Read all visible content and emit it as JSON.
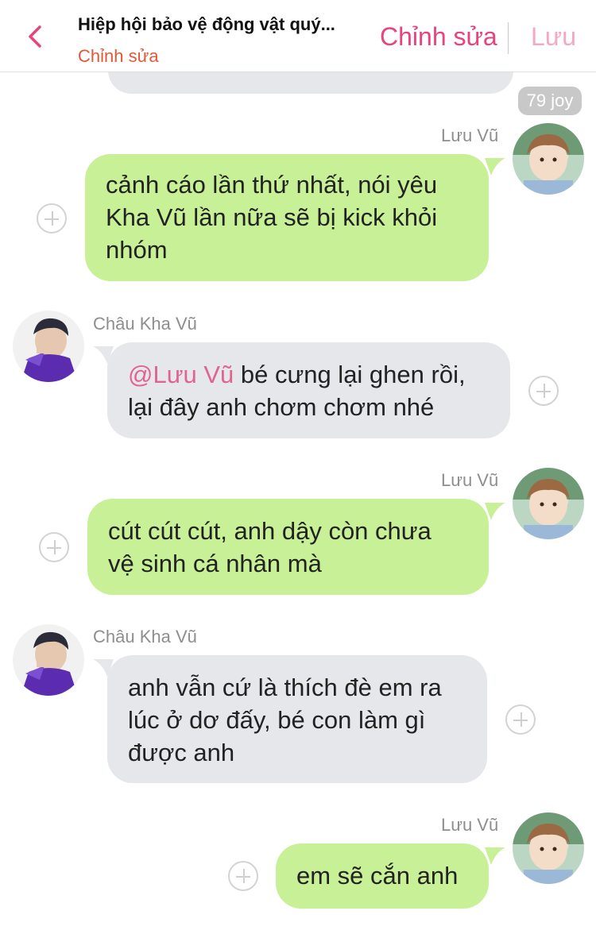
{
  "header": {
    "back_icon": "chevron-left-icon",
    "title": "Hiệp hội bảo vệ động vật quý...",
    "subtitle": "Chỉnh sửa",
    "edit_label": "Chỉnh sửa",
    "save_label": "Lưu",
    "accent_color": "#e8447a"
  },
  "joy_badge": "79 joy",
  "messages": [
    {
      "sender": "Lưu Vũ",
      "side": "right",
      "lines": [
        "cảnh cáo lần thứ nhất, nói yêu",
        "Kha Vũ lần nữa sẽ bị kick khỏi",
        "nhóm"
      ]
    },
    {
      "sender": "Châu Kha Vũ",
      "side": "left",
      "mention": "@Lưu Vũ",
      "lines": [
        "bé cưng lại ghen rồi,",
        "lại đây anh chơm chơm nhé"
      ]
    },
    {
      "sender": "Lưu Vũ",
      "side": "right",
      "lines": [
        "cút cút cút, anh dậy còn chưa",
        "vệ sinh cá nhân mà"
      ]
    },
    {
      "sender": "Châu Kha Vũ",
      "side": "left",
      "lines": [
        "anh vẫn cứ là thích đè em ra",
        "lúc ở dơ đấy, bé con làm gì",
        "được anh"
      ]
    },
    {
      "sender": "Lưu Vũ",
      "side": "right",
      "lines": [
        "em sẽ cắn anh"
      ]
    }
  ],
  "colors": {
    "outgoing_bubble": "#c8f097",
    "incoming_bubble": "#e5e7eb",
    "mention": "#e0648e"
  }
}
